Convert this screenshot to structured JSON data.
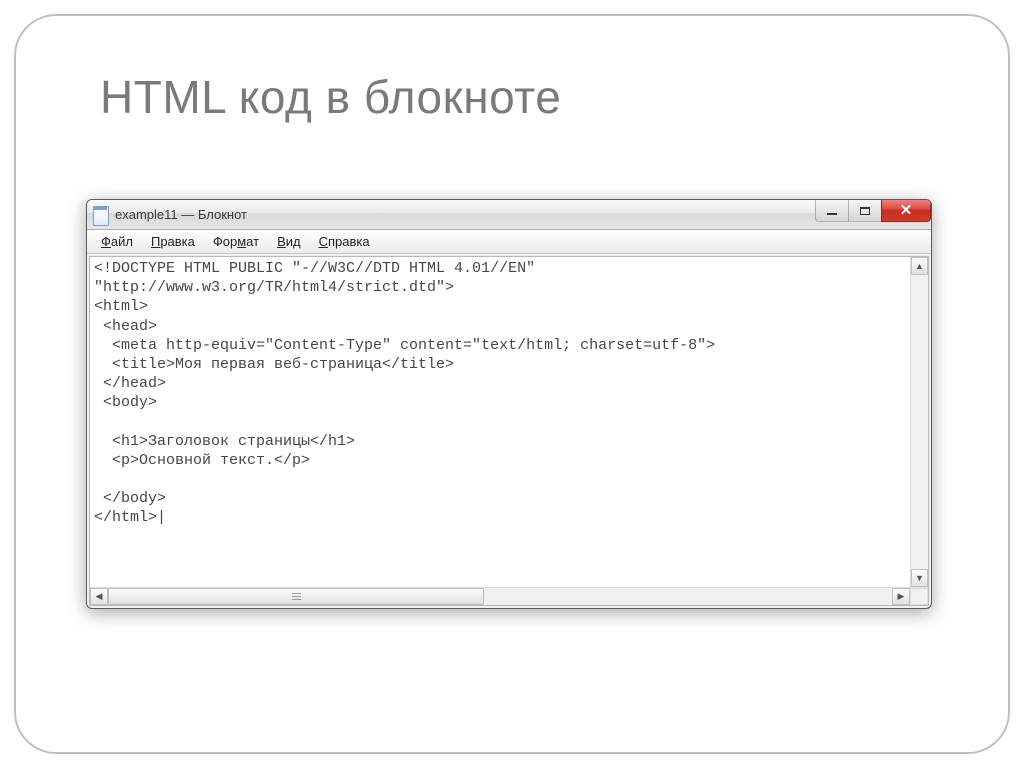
{
  "slide": {
    "title": "HTML код  в блокноте"
  },
  "window": {
    "title": "example11 — Блокнот",
    "menu": {
      "file": {
        "label": "Файл",
        "hotkey_index": 0
      },
      "edit": {
        "label": "Правка",
        "hotkey_index": 0
      },
      "format": {
        "label": "Формат",
        "hotkey_index": 3
      },
      "view": {
        "label": "Вид",
        "hotkey_index": 0
      },
      "help": {
        "label": "Справка",
        "hotkey_index": 0
      }
    },
    "content_lines": [
      "<!DOCTYPE HTML PUBLIC \"-//W3C//DTD HTML 4.01//EN\"",
      "\"http://www.w3.org/TR/html4/strict.dtd\">",
      "<html>",
      " <head>",
      "  <meta http-equiv=\"Content-Type\" content=\"text/html; charset=utf-8\">",
      "  <title>Моя первая веб-страница</title>",
      " </head>",
      " <body>",
      "",
      "  <h1>Заголовок страницы</h1>",
      "  <p>Основной текст.</p>",
      "",
      " </body>",
      "</html>|"
    ]
  }
}
